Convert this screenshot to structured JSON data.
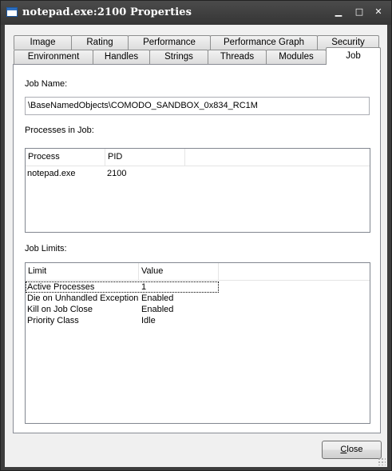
{
  "window": {
    "title": "notepad.exe:2100 Properties"
  },
  "titlebar_buttons": {
    "minimize": "▁",
    "maximize": "□",
    "close": "✕"
  },
  "tabs_row1": [
    {
      "label": "Image"
    },
    {
      "label": "Rating"
    },
    {
      "label": "Performance"
    },
    {
      "label": "Performance Graph"
    },
    {
      "label": "Security"
    }
  ],
  "tabs_row2": [
    {
      "label": "Environment"
    },
    {
      "label": "Handles"
    },
    {
      "label": "Strings"
    },
    {
      "label": "Threads"
    },
    {
      "label": "Modules"
    },
    {
      "label": "Job",
      "active": true
    }
  ],
  "job": {
    "job_name_label": "Job Name:",
    "job_name_value": "\\BaseNamedObjects\\COMODO_SANDBOX_0x834_RC1M",
    "processes_label": "Processes in Job:",
    "processes_columns": [
      "Process",
      "PID"
    ],
    "processes_rows": [
      {
        "process": "notepad.exe",
        "pid": "2100"
      }
    ],
    "limits_label": "Job Limits:",
    "limits_columns": [
      "Limit",
      "Value"
    ],
    "limits_rows": [
      {
        "limit": "Active Processes",
        "value": "1"
      },
      {
        "limit": "Die on Unhandled Exception",
        "value": "Enabled"
      },
      {
        "limit": "Kill on Job Close",
        "value": "Enabled"
      },
      {
        "limit": "Priority Class",
        "value": "Idle"
      }
    ]
  },
  "buttons": {
    "close_accel": "C",
    "close_rest": "lose"
  }
}
